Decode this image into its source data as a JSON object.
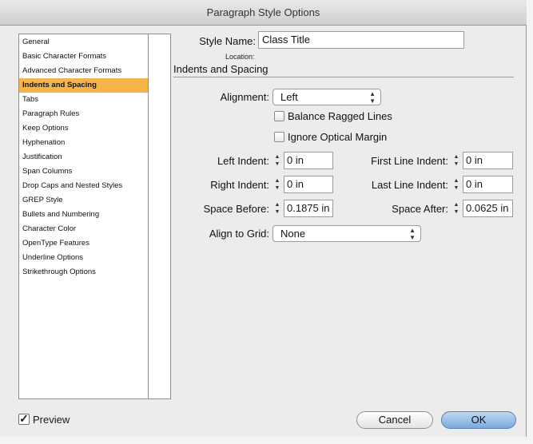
{
  "window": {
    "title": "Paragraph Style Options"
  },
  "sidebar": {
    "items": [
      "General",
      "Basic Character Formats",
      "Advanced Character Formats",
      "Indents and Spacing",
      "Tabs",
      "Paragraph Rules",
      "Keep Options",
      "Hyphenation",
      "Justification",
      "Span Columns",
      "Drop Caps and Nested Styles",
      "GREP Style",
      "Bullets and Numbering",
      "Character Color",
      "OpenType Features",
      "Underline Options",
      "Strikethrough Options"
    ],
    "selected_index": 3
  },
  "form": {
    "style_name_label": "Style Name:",
    "style_name_value": "Class Title",
    "location_label": "Location:",
    "section_title": "Indents and Spacing",
    "alignment_label": "Alignment:",
    "alignment_value": "Left",
    "balance_label": "Balance Ragged Lines",
    "balance_checked": false,
    "ignore_label": "Ignore Optical Margin",
    "ignore_checked": false,
    "left_indent_label": "Left Indent:",
    "left_indent_value": "0 in",
    "first_line_label": "First Line Indent:",
    "first_line_value": "0 in",
    "right_indent_label": "Right Indent:",
    "right_indent_value": "0 in",
    "last_line_label": "Last Line Indent:",
    "last_line_value": "0 in",
    "space_before_label": "Space Before:",
    "space_before_value": "0.1875 in",
    "space_after_label": "Space After:",
    "space_after_value": "0.0625 in",
    "grid_label": "Align to Grid:",
    "grid_value": "None"
  },
  "footer": {
    "preview_label": "Preview",
    "preview_checked": true,
    "cancel_label": "Cancel",
    "ok_label": "OK"
  },
  "icons": {
    "spinner": "stepper-arrows-icon",
    "popup": "popup-arrows-icon",
    "check": "checkmark-icon"
  },
  "colors": {
    "selection": "#f5b54a",
    "default_button": "#7aa9dd"
  }
}
